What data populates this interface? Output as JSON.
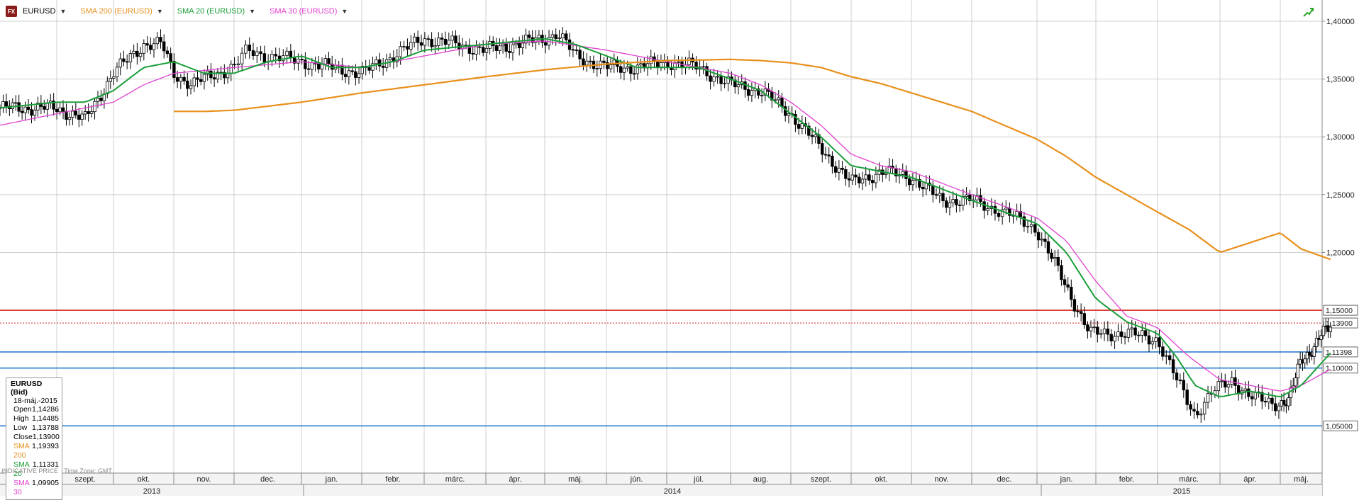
{
  "toolbar": {
    "badge": "FX",
    "symbol": "EURUSD",
    "sma200_label": "SMA 200 (EURUSD)",
    "sma20_label": "SMA 20 (EURUSD)",
    "sma30_label": "SMA 30 (EURUSD)",
    "corner_icon": "trend-arrow-icon"
  },
  "info_box": {
    "title": "EURUSD (Bid)",
    "date": "18-máj.-2015",
    "rows": [
      {
        "label": "Open",
        "value": "1,14286"
      },
      {
        "label": "High",
        "value": "1,14485"
      },
      {
        "label": "Low",
        "value": "1,13788"
      },
      {
        "label": "Close",
        "value": "1,13900"
      },
      {
        "label": "SMA 200",
        "value": "1,19393"
      },
      {
        "label": "SMA 20",
        "value": "1,11331"
      },
      {
        "label": "SMA 30",
        "value": "1,09905"
      }
    ]
  },
  "footer": {
    "indicative": "INDICATIVE PRICE",
    "timezone": "Time Zone: GMT"
  },
  "colors": {
    "sma200": "#e8901c",
    "sma20": "#1a9e3a",
    "sma30": "#e040d0",
    "grid": "#cfcfcf",
    "red_line": "#d42020",
    "blue_line": "#2b7fd0",
    "candle_up": "#ffffff",
    "candle_down": "#000000"
  },
  "chart_data": {
    "type": "candlestick",
    "instrument": "EURUSD",
    "ylim": [
      1.03,
      1.4
    ],
    "y_ticks": [
      "1,40000",
      "1,35000",
      "1,30000",
      "1,25000",
      "1,20000"
    ],
    "x_months": [
      "aug.",
      "szept.",
      "okt.",
      "nov.",
      "dec.",
      "jan.",
      "febr.",
      "márc.",
      "ápr.",
      "máj.",
      "jún.",
      "júl.",
      "aug.",
      "szept.",
      "okt.",
      "nov.",
      "dec.",
      "jan.",
      "febr.",
      "márc.",
      "ápr.",
      "máj."
    ],
    "x_years": [
      "2013",
      "2014",
      "2015"
    ],
    "month_index_start": 0,
    "price_anchors": [
      [
        0,
        1.325
      ],
      [
        1,
        1.325
      ],
      [
        1.5,
        1.315
      ],
      [
        2,
        1.355
      ],
      [
        2.5,
        1.38
      ],
      [
        2.8,
        1.38
      ],
      [
        3,
        1.355
      ],
      [
        3.3,
        1.345
      ],
      [
        3.7,
        1.355
      ],
      [
        4,
        1.36
      ],
      [
        4.2,
        1.375
      ],
      [
        4.5,
        1.37
      ],
      [
        5,
        1.365
      ],
      [
        5.5,
        1.36
      ],
      [
        6,
        1.355
      ],
      [
        6.5,
        1.37
      ],
      [
        7,
        1.385
      ],
      [
        7.5,
        1.38
      ],
      [
        8,
        1.375
      ],
      [
        8.5,
        1.38
      ],
      [
        9,
        1.385
      ],
      [
        9.2,
        1.39
      ],
      [
        9.5,
        1.37
      ],
      [
        10,
        1.36
      ],
      [
        10.5,
        1.36
      ],
      [
        11,
        1.365
      ],
      [
        11.5,
        1.36
      ],
      [
        12,
        1.345
      ],
      [
        12.5,
        1.34
      ],
      [
        13,
        1.32
      ],
      [
        13.5,
        1.29
      ],
      [
        14,
        1.26
      ],
      [
        14.5,
        1.27
      ],
      [
        15,
        1.265
      ],
      [
        15.5,
        1.245
      ],
      [
        16,
        1.245
      ],
      [
        16.5,
        1.235
      ],
      [
        17,
        1.22
      ],
      [
        17.3,
        1.19
      ],
      [
        17.6,
        1.16
      ],
      [
        17.9,
        1.13
      ],
      [
        18.1,
        1.13
      ],
      [
        18.5,
        1.13
      ],
      [
        19,
        1.125
      ],
      [
        19.3,
        1.09
      ],
      [
        19.6,
        1.06
      ],
      [
        19.9,
        1.08
      ],
      [
        20.2,
        1.09
      ],
      [
        20.5,
        1.075
      ],
      [
        20.9,
        1.07
      ],
      [
        21.2,
        1.07
      ],
      [
        21.5,
        1.11
      ],
      [
        21.8,
        1.115
      ],
      [
        22.0,
        1.13
      ],
      [
        22.2,
        1.139
      ]
    ],
    "sma20_anchors": [
      [
        0,
        1.325
      ],
      [
        1,
        1.33
      ],
      [
        1.5,
        1.33
      ],
      [
        2,
        1.34
      ],
      [
        2.5,
        1.36
      ],
      [
        3,
        1.365
      ],
      [
        3.5,
        1.355
      ],
      [
        4,
        1.355
      ],
      [
        4.5,
        1.365
      ],
      [
        5,
        1.37
      ],
      [
        5.5,
        1.36
      ],
      [
        6,
        1.36
      ],
      [
        6.5,
        1.365
      ],
      [
        7,
        1.375
      ],
      [
        8,
        1.38
      ],
      [
        9,
        1.385
      ],
      [
        9.5,
        1.38
      ],
      [
        10,
        1.37
      ],
      [
        10.5,
        1.36
      ],
      [
        11,
        1.36
      ],
      [
        11.5,
        1.36
      ],
      [
        12,
        1.35
      ],
      [
        12.5,
        1.34
      ],
      [
        13,
        1.32
      ],
      [
        13.5,
        1.3
      ],
      [
        14,
        1.275
      ],
      [
        14.5,
        1.27
      ],
      [
        15,
        1.265
      ],
      [
        15.5,
        1.255
      ],
      [
        16,
        1.245
      ],
      [
        16.5,
        1.235
      ],
      [
        17,
        1.225
      ],
      [
        17.5,
        1.2
      ],
      [
        18,
        1.16
      ],
      [
        18.5,
        1.14
      ],
      [
        19,
        1.13
      ],
      [
        19.3,
        1.11
      ],
      [
        19.6,
        1.085
      ],
      [
        20,
        1.075
      ],
      [
        20.5,
        1.08
      ],
      [
        21,
        1.075
      ],
      [
        21.5,
        1.085
      ],
      [
        22,
        1.105
      ],
      [
        22.2,
        1.113
      ]
    ],
    "sma30_anchors": [
      [
        0,
        1.31
      ],
      [
        1,
        1.32
      ],
      [
        2,
        1.33
      ],
      [
        2.5,
        1.345
      ],
      [
        3,
        1.355
      ],
      [
        4,
        1.36
      ],
      [
        5,
        1.365
      ],
      [
        6,
        1.36
      ],
      [
        7,
        1.37
      ],
      [
        8,
        1.38
      ],
      [
        9,
        1.383
      ],
      [
        10,
        1.375
      ],
      [
        10.5,
        1.37
      ],
      [
        11,
        1.365
      ],
      [
        11.5,
        1.36
      ],
      [
        12,
        1.355
      ],
      [
        12.5,
        1.345
      ],
      [
        13,
        1.33
      ],
      [
        13.5,
        1.31
      ],
      [
        14,
        1.285
      ],
      [
        14.5,
        1.275
      ],
      [
        15,
        1.27
      ],
      [
        15.5,
        1.26
      ],
      [
        16,
        1.25
      ],
      [
        16.5,
        1.24
      ],
      [
        17,
        1.23
      ],
      [
        17.5,
        1.21
      ],
      [
        18,
        1.175
      ],
      [
        18.5,
        1.145
      ],
      [
        19,
        1.135
      ],
      [
        19.5,
        1.11
      ],
      [
        20,
        1.09
      ],
      [
        20.5,
        1.085
      ],
      [
        21,
        1.08
      ],
      [
        21.5,
        1.085
      ],
      [
        22,
        1.095
      ],
      [
        22.2,
        1.099
      ]
    ],
    "sma200_anchors": [
      [
        3,
        1.322
      ],
      [
        3.5,
        1.322
      ],
      [
        4,
        1.323
      ],
      [
        5,
        1.33
      ],
      [
        6,
        1.338
      ],
      [
        7,
        1.345
      ],
      [
        8,
        1.352
      ],
      [
        9,
        1.358
      ],
      [
        10,
        1.363
      ],
      [
        11,
        1.366
      ],
      [
        12,
        1.367
      ],
      [
        12.5,
        1.366
      ],
      [
        13,
        1.364
      ],
      [
        13.5,
        1.36
      ],
      [
        14,
        1.352
      ],
      [
        14.5,
        1.346
      ],
      [
        15,
        1.338
      ],
      [
        15.5,
        1.33
      ],
      [
        16,
        1.322
      ],
      [
        16.5,
        1.31
      ],
      [
        17,
        1.298
      ],
      [
        17.5,
        1.283
      ],
      [
        18,
        1.265
      ],
      [
        18.5,
        1.25
      ],
      [
        19,
        1.235
      ],
      [
        19.5,
        1.22
      ],
      [
        20,
        1.2
      ],
      [
        21,
        1.217
      ],
      [
        21.5,
        1.203
      ],
      [
        22.2,
        1.194
      ]
    ],
    "horizontal_lines": [
      {
        "value": 1.15,
        "label": "1,15000",
        "color": "red",
        "style": "solid"
      },
      {
        "value": 1.139,
        "label": "1,13900",
        "color": "red",
        "style": "dotted"
      },
      {
        "value": 1.11398,
        "label": "1,11398",
        "color": "blue",
        "style": "solid"
      },
      {
        "value": 1.1,
        "label": "1,10000",
        "color": "blue",
        "style": "solid"
      },
      {
        "value": 1.05,
        "label": "1,05000",
        "color": "blue",
        "style": "solid"
      }
    ],
    "grid": true
  }
}
